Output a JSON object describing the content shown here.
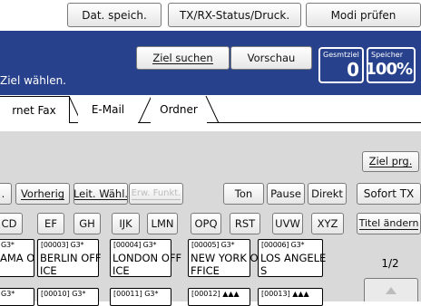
{
  "top_buttons": {
    "dat_speich": "Dat. speich.",
    "tx_rx_status": "TX/RX-Status/Druck.",
    "modi_pruefen": "Modi prüfen"
  },
  "header": {
    "ziel_suchen": "Ziel suchen",
    "vorschau": "Vorschau",
    "instruction": "Ziel wählen.",
    "gesmtziel_label": "Gesmtziel",
    "gesmtziel_value": "0",
    "speicher_label": "Speicher",
    "speicher_value": "100%"
  },
  "tabs": [
    "rnet Fax",
    "E-Mail",
    "Ordner"
  ],
  "ziel_prg": "Ziel prg.",
  "toolbar": {
    "vorherig": "Vorherig",
    "leit_wahl": "Leit. Wähl.",
    "erw_funkt": "Erw. Funkt.",
    "ton": "Ton",
    "pause": "Pause",
    "direkt": "Direkt",
    "sofort_tx": "Sofort TX"
  },
  "index_keys": [
    "CD",
    "EF",
    "GH",
    "IJK",
    "LMN",
    "OPQ",
    "RST",
    "UVW",
    "XYZ"
  ],
  "titel_aendern": "Titel ändern",
  "destinations_row1": [
    {
      "code": "G3*",
      "line1": "AMA O",
      "line2": ""
    },
    {
      "code": "[00003] G3*",
      "line1": "BERLIN OFF",
      "line2": "ICE"
    },
    {
      "code": "[00004] G3*",
      "line1": "LONDON OFF",
      "line2": "ICE"
    },
    {
      "code": "[00005] G3*",
      "line1": "NEW YORK O",
      "line2": "FFICE"
    },
    {
      "code": "[00006] G3*",
      "line1": "LOS ANGELE",
      "line2": "S"
    }
  ],
  "destinations_row2": [
    {
      "code": "G3*"
    },
    {
      "code": "[00010] G3*"
    },
    {
      "code": "[00011] G3*"
    },
    {
      "code": "[00012] ▲▲▲"
    },
    {
      "code": "[00013] ▲▲▲"
    }
  ],
  "page_indicator": "1/2",
  "colors": {
    "panel_blue": "#27418c",
    "accent": "#1c3a8a"
  },
  "icons": [
    "scroll-up-icon",
    "group-icon"
  ]
}
